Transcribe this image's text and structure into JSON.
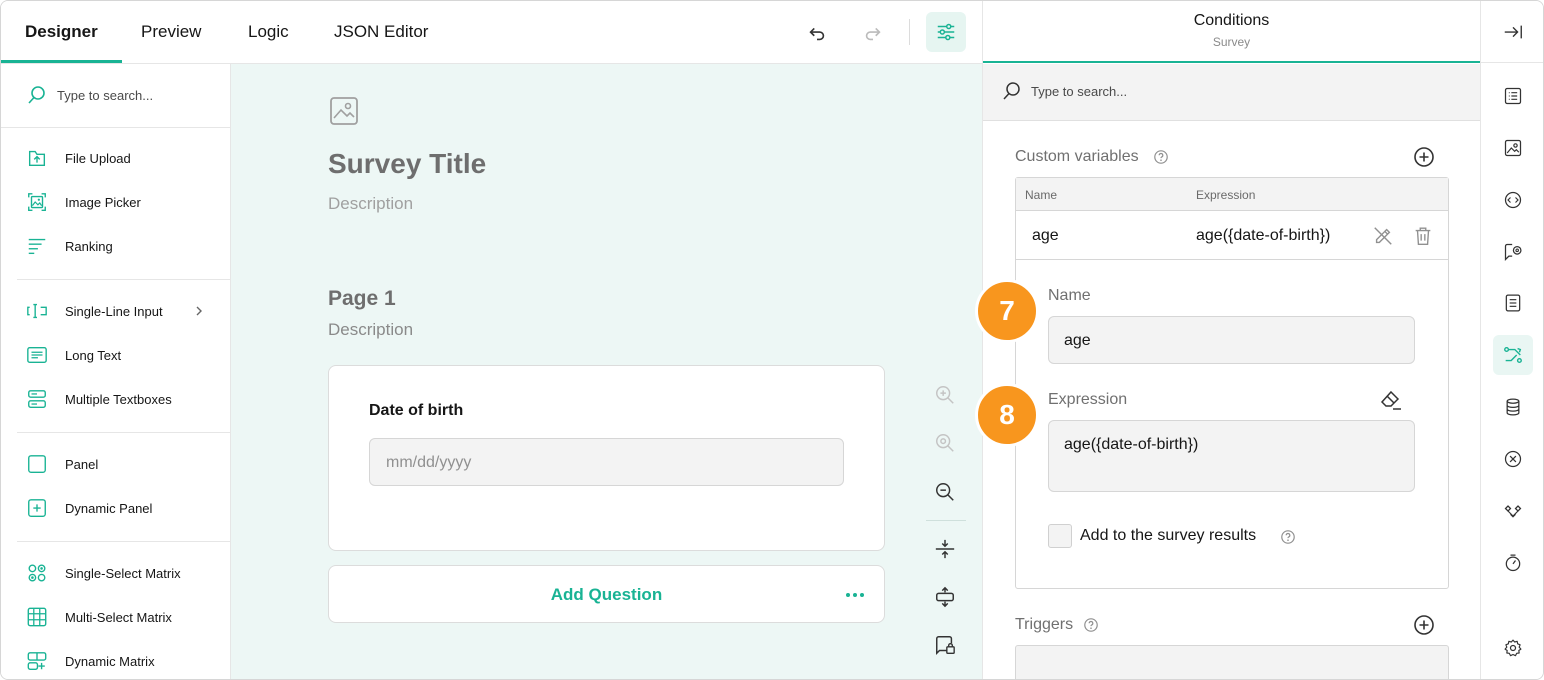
{
  "tabs": [
    "Designer",
    "Preview",
    "Logic",
    "JSON Editor"
  ],
  "toolbox": {
    "search_placeholder": "Type to search...",
    "items": [
      {
        "label": "File Upload",
        "icon": "file-upload-icon"
      },
      {
        "label": "Image Picker",
        "icon": "image-picker-icon"
      },
      {
        "label": "Ranking",
        "icon": "ranking-icon"
      },
      {
        "label": "Single-Line Input",
        "icon": "single-line-input-icon"
      },
      {
        "label": "Long Text",
        "icon": "long-text-icon"
      },
      {
        "label": "Multiple Textboxes",
        "icon": "multiple-textboxes-icon"
      },
      {
        "label": "Panel",
        "icon": "panel-icon"
      },
      {
        "label": "Dynamic Panel",
        "icon": "dynamic-panel-icon"
      },
      {
        "label": "Single-Select Matrix",
        "icon": "single-select-matrix-icon"
      },
      {
        "label": "Multi-Select Matrix",
        "icon": "multi-select-matrix-icon"
      },
      {
        "label": "Dynamic Matrix",
        "icon": "dynamic-matrix-icon"
      }
    ]
  },
  "survey": {
    "title": "Survey Title",
    "description": "Description",
    "page_title": "Page 1",
    "page_description": "Description",
    "question_title": "Date of birth",
    "question_placeholder": "mm/dd/yyyy",
    "add_question": "Add Question"
  },
  "panel": {
    "title": "Conditions",
    "subtitle": "Survey",
    "search_placeholder": "Type to search...",
    "custom_variables_label": "Custom variables",
    "col_name": "Name",
    "col_expression": "Expression",
    "row_name": "age",
    "row_expression": "age({date-of-birth})",
    "name_label": "Name",
    "name_value": "age",
    "expression_label": "Expression",
    "expression_value": "age({date-of-birth})",
    "checkbox_label": "Add to the survey results",
    "triggers_label": "Triggers",
    "step_7": "7",
    "step_8": "8"
  },
  "colors": {
    "accent": "#19b394",
    "step": "#f8961e",
    "canvas": "#edf7f5"
  }
}
